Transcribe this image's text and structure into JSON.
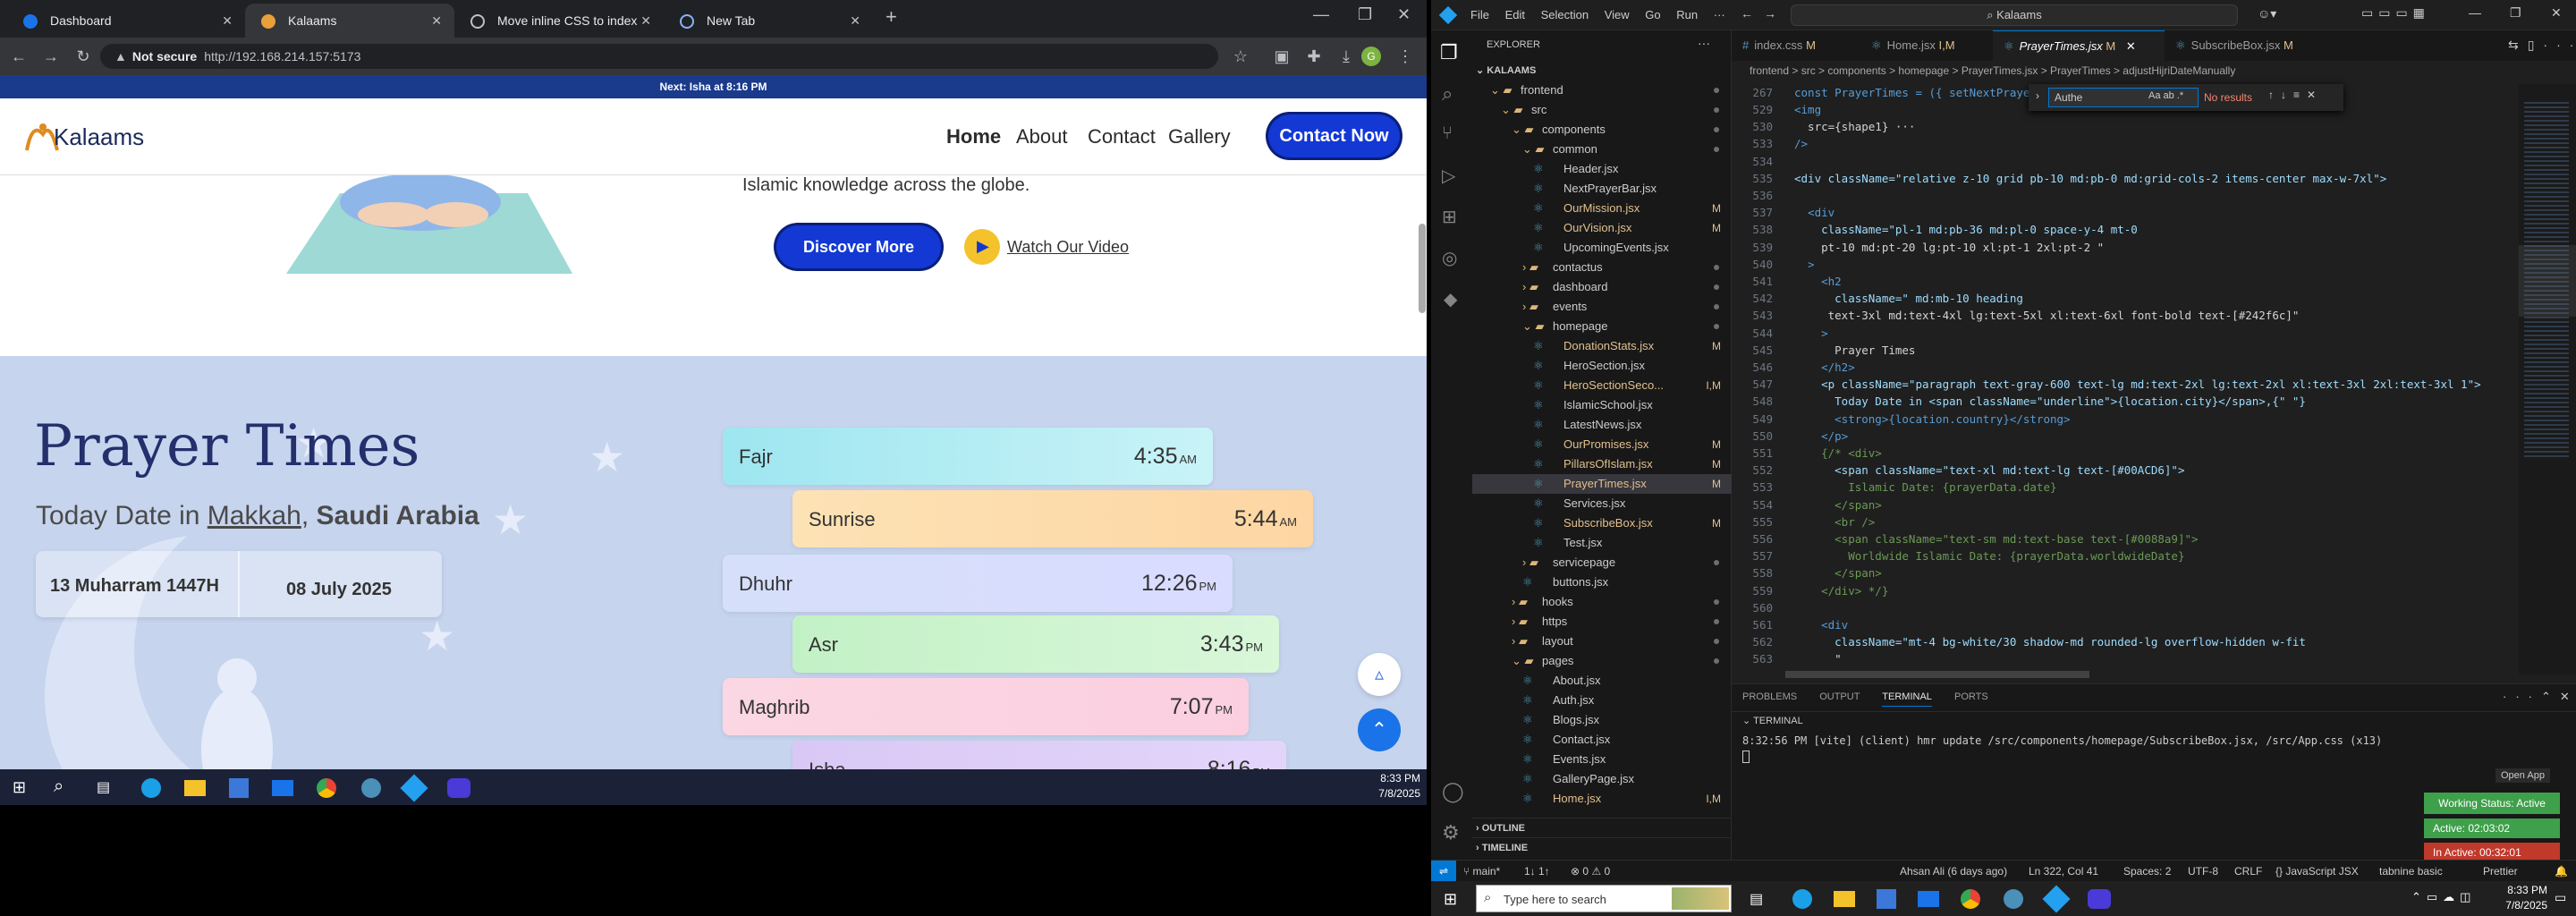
{
  "browser": {
    "tabs": [
      {
        "title": "Dashboard",
        "color": "#1a73e8"
      },
      {
        "title": "Kalaams",
        "color": "#e8a03a"
      },
      {
        "title": "Move inline CSS to index",
        "color": "#bdc1c6"
      },
      {
        "title": "New Tab",
        "color": "#8ab4f8"
      }
    ],
    "not_secure": "Not secure",
    "url": "http://192.168.214.157:5173",
    "notif": "Next: Isha at 8:16 PM"
  },
  "site": {
    "logo": "Kalaams",
    "nav": [
      "Home",
      "About",
      "Contact",
      "Gallery"
    ],
    "contact_btn": "Contact Now",
    "hero_text": "Islamic knowledge across the globe.",
    "discover_btn": "Discover More",
    "video_link": "Watch Our Video",
    "prayer": {
      "title": "Prayer Times",
      "today_prefix": "Today Date in",
      "city": "Makkah",
      "country": "Saudi Arabia",
      "hijri": "13 Muharram 1447H",
      "gregorian": "08 July 2025",
      "items": [
        {
          "name": "Fajr",
          "time": "4:35",
          "ampm": "AM"
        },
        {
          "name": "Sunrise",
          "time": "5:44",
          "ampm": "AM"
        },
        {
          "name": "Dhuhr",
          "time": "12:26",
          "ampm": "PM"
        },
        {
          "name": "Asr",
          "time": "3:43",
          "ampm": "PM"
        },
        {
          "name": "Maghrib",
          "time": "7:07",
          "ampm": "PM"
        },
        {
          "name": "Isha",
          "time": "8:16",
          "ampm": "PM"
        }
      ]
    }
  },
  "taskbar_left": {
    "time": "8:33 PM",
    "date": "7/8/2025"
  },
  "vscode": {
    "menu": [
      "File",
      "Edit",
      "Selection",
      "View",
      "Go",
      "Run"
    ],
    "search": "Kalaams",
    "explorer_title": "EXPLORER",
    "root": "KALAAMS",
    "tree": [
      {
        "label": "frontend",
        "kind": "folder-open",
        "depth": 1
      },
      {
        "label": "src",
        "kind": "folder-open",
        "depth": 2
      },
      {
        "label": "components",
        "kind": "folder-open",
        "depth": 3
      },
      {
        "label": "common",
        "kind": "folder-open",
        "depth": 4
      },
      {
        "label": "Header.jsx",
        "kind": "file",
        "depth": 5,
        "mod": ""
      },
      {
        "label": "NextPrayerBar.jsx",
        "kind": "file",
        "depth": 5,
        "mod": ""
      },
      {
        "label": "OurMission.jsx",
        "kind": "file",
        "depth": 5,
        "mod": "M"
      },
      {
        "label": "OurVision.jsx",
        "kind": "file",
        "depth": 5,
        "mod": "M"
      },
      {
        "label": "UpcomingEvents.jsx",
        "kind": "file",
        "depth": 5,
        "mod": ""
      },
      {
        "label": "contactus",
        "kind": "folder",
        "depth": 4
      },
      {
        "label": "dashboard",
        "kind": "folder",
        "depth": 4
      },
      {
        "label": "events",
        "kind": "folder",
        "depth": 4
      },
      {
        "label": "homepage",
        "kind": "folder-open",
        "depth": 4
      },
      {
        "label": "DonationStats.jsx",
        "kind": "file",
        "depth": 5,
        "mod": "M"
      },
      {
        "label": "HeroSection.jsx",
        "kind": "file",
        "depth": 5,
        "mod": ""
      },
      {
        "label": "HeroSectionSeco...",
        "kind": "file",
        "depth": 5,
        "mod": "I,M"
      },
      {
        "label": "IslamicSchool.jsx",
        "kind": "file",
        "depth": 5,
        "mod": ""
      },
      {
        "label": "LatestNews.jsx",
        "kind": "file",
        "depth": 5,
        "mod": ""
      },
      {
        "label": "OurPromises.jsx",
        "kind": "file",
        "depth": 5,
        "mod": "M"
      },
      {
        "label": "PillarsOfIslam.jsx",
        "kind": "file",
        "depth": 5,
        "mod": "M"
      },
      {
        "label": "PrayerTimes.jsx",
        "kind": "file",
        "depth": 5,
        "mod": "M",
        "selected": true
      },
      {
        "label": "Services.jsx",
        "kind": "file",
        "depth": 5,
        "mod": ""
      },
      {
        "label": "SubscribeBox.jsx",
        "kind": "file",
        "depth": 5,
        "mod": "M"
      },
      {
        "label": "Test.jsx",
        "kind": "file",
        "depth": 5,
        "mod": ""
      },
      {
        "label": "servicepage",
        "kind": "folder",
        "depth": 4
      },
      {
        "label": "buttons.jsx",
        "kind": "file",
        "depth": 4,
        "mod": ""
      },
      {
        "label": "hooks",
        "kind": "folder",
        "depth": 3
      },
      {
        "label": "https",
        "kind": "folder",
        "depth": 3
      },
      {
        "label": "layout",
        "kind": "folder",
        "depth": 3
      },
      {
        "label": "pages",
        "kind": "folder-open",
        "depth": 3
      },
      {
        "label": "About.jsx",
        "kind": "file",
        "depth": 4,
        "mod": ""
      },
      {
        "label": "Auth.jsx",
        "kind": "file",
        "depth": 4,
        "mod": ""
      },
      {
        "label": "Blogs.jsx",
        "kind": "file",
        "depth": 4,
        "mod": ""
      },
      {
        "label": "Contact.jsx",
        "kind": "file",
        "depth": 4,
        "mod": ""
      },
      {
        "label": "Events.jsx",
        "kind": "file",
        "depth": 4,
        "mod": ""
      },
      {
        "label": "GalleryPage.jsx",
        "kind": "file",
        "depth": 4,
        "mod": ""
      },
      {
        "label": "Home.jsx",
        "kind": "file",
        "depth": 4,
        "mod": "I,M"
      }
    ],
    "outline": "OUTLINE",
    "timeline": "TIMELINE",
    "tabs": [
      {
        "label": "index.css",
        "mod": "M"
      },
      {
        "label": "Home.jsx",
        "mod": "I,M"
      },
      {
        "label": "PrayerTimes.jsx",
        "mod": "M",
        "active": true
      },
      {
        "label": "SubscribeBox.jsx",
        "mod": "M"
      }
    ],
    "breadcrumb": "frontend > src > components > homepage > PrayerTimes.jsx > PrayerTimes > adjustHijriDateManually",
    "find_value": "Authe",
    "find_result": "No results",
    "sticky_line": {
      "n": "267",
      "code": "const PrayerTimes = ({ setNextPrayer, nextPra"
    },
    "code": [
      {
        "n": "529",
        "code": "<img"
      },
      {
        "n": "530",
        "code": "  src={shape1} ···"
      },
      {
        "n": "533",
        "code": "/>"
      },
      {
        "n": "534",
        "code": ""
      },
      {
        "n": "535",
        "code": "<div className=\"relative z-10 grid pb-10 md:pb-0 md:grid-cols-2 items-center max-w-7xl\">"
      },
      {
        "n": "536",
        "code": ""
      },
      {
        "n": "537",
        "code": "  <div"
      },
      {
        "n": "538",
        "code": "    className=\"pl-1 md:pb-36 md:pl-0 space-y-4 mt-0"
      },
      {
        "n": "539",
        "code": "    pt-10 md:pt-20 lg:pt-10 xl:pt-1 2xl:pt-2 \""
      },
      {
        "n": "540",
        "code": "  >"
      },
      {
        "n": "541",
        "code": "    <h2"
      },
      {
        "n": "542",
        "code": "      className=\" md:mb-10 heading"
      },
      {
        "n": "543",
        "code": "     text-3xl md:text-4xl lg:text-5xl xl:text-6xl font-bold text-[#242f6c]\""
      },
      {
        "n": "544",
        "code": "    >"
      },
      {
        "n": "545",
        "code": "      Prayer Times"
      },
      {
        "n": "546",
        "code": "    </h2>"
      },
      {
        "n": "547",
        "code": "    <p className=\"paragraph text-gray-600 text-lg md:text-2xl lg:text-2xl xl:text-3xl 2xl:text-3xl 1\">"
      },
      {
        "n": "548",
        "code": "      Today Date in <span className=\"underline\">{location.city}</span>,{\" \"}"
      },
      {
        "n": "549",
        "code": "      <strong>{location.country}</strong>"
      },
      {
        "n": "550",
        "code": "    </p>"
      },
      {
        "n": "551",
        "code": "    {/* <div>"
      },
      {
        "n": "552",
        "code": "      <span className=\"text-xl md:text-lg text-[#00ACD6]\">"
      },
      {
        "n": "553",
        "code": "        Islamic Date: {prayerData.date}"
      },
      {
        "n": "554",
        "code": "      </span>"
      },
      {
        "n": "555",
        "code": "      <br />"
      },
      {
        "n": "556",
        "code": "      <span className=\"text-sm md:text-base text-[#0088a9]\">"
      },
      {
        "n": "557",
        "code": "        Worldwide Islamic Date: {prayerData.worldwideDate}"
      },
      {
        "n": "558",
        "code": "      </span>"
      },
      {
        "n": "559",
        "code": "    </div> */}"
      },
      {
        "n": "560",
        "code": ""
      },
      {
        "n": "561",
        "code": "    <div"
      },
      {
        "n": "562",
        "code": "      className=\"mt-4 bg-white/30 shadow-md rounded-lg overflow-hidden w-fit"
      },
      {
        "n": "563",
        "code": "      \""
      }
    ],
    "panel_tabs": [
      "PROBLEMS",
      "OUTPUT",
      "TERMINAL",
      "PORTS"
    ],
    "terminal_title": "TERMINAL",
    "terminal_line": "8:32:56 PM [vite] (client) hmr update /src/components/homepage/SubscribeBox.jsx, /src/App.css (x13)",
    "open_app": "Open App",
    "working_status": "Working Status: Active",
    "active_time": "Active: 02:03:02",
    "inactive_time": "In Active: 00:32:01",
    "status": {
      "branch": "main*",
      "sync": "1↓ 1↑",
      "errors": "⊗ 0 ⚠ 0",
      "blame": "Ahsan Ali (6 days ago)",
      "pos": "Ln 322, Col 41",
      "spaces": "Spaces: 2",
      "enc": "UTF-8",
      "eol": "CRLF",
      "lang": "{} JavaScript JSX",
      "tabnine": "tabnine basic",
      "prettier": "Prettier"
    }
  },
  "taskbar_right": {
    "search": "Type here to search",
    "time": "8:33 PM",
    "date": "7/8/2025"
  }
}
